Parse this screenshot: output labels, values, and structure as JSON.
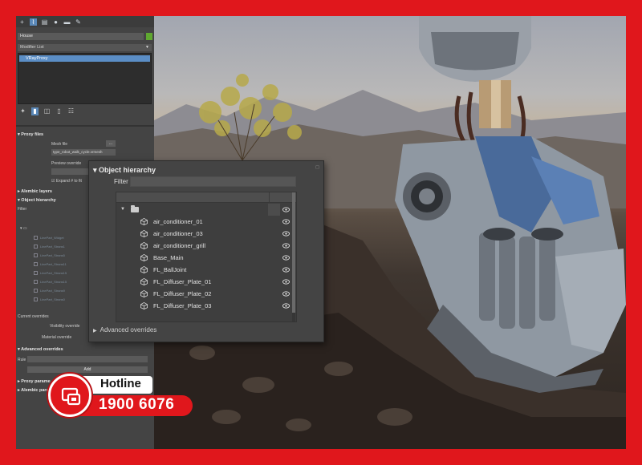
{
  "colors": {
    "border": "#e0171c",
    "panel": "#444444",
    "selection": "#5b8ec6",
    "swatch": "#5fa830"
  },
  "command_panel": {
    "toolbar_icons": [
      "plus-icon",
      "curve-icon",
      "hierarchy-icon",
      "motion-icon",
      "display-icon",
      "utilities-icon"
    ],
    "object_name": "House",
    "modifier_list": "Modifier List",
    "stack": [
      "VRayProxy"
    ],
    "proxy_files": {
      "header": "Proxy files",
      "mesh_file_label": "Mesh file",
      "browse_label": "...",
      "mesh_file_value": "type_robot_walk_cycle.vrmesh",
      "preview_override_label": "Preview override",
      "expand_label": "Expand # to fit"
    },
    "alembic_layers": "Alembic layers",
    "object_hierarchy": "Object hierarchy",
    "filter": "Filter",
    "ghost_items": [
      "LinePart_Widget",
      "LinePart_Strans1",
      "LinePart_Strans5",
      "LinePart_Strans11",
      "LinePart_Strans15",
      "LinePart_Strans15",
      "LinePart_Strans9",
      "LinePart_Strans0"
    ],
    "current_overrides": "Current overrides",
    "visibility_override": "Visibility override",
    "material_override": "Material override",
    "advanced_overrides": "Advanced overrides",
    "rule_label": "Rule",
    "add_button": "Add",
    "proxy_params": "Proxy parame",
    "alembic_params": "Alembic para"
  },
  "dialog": {
    "title": "Object hierarchy",
    "filter_label": "Filter",
    "items": [
      "air_conditioner_01",
      "air_conditioner_03",
      "air_conditioner_grill",
      "Base_Main",
      "FL_BallJoint",
      "FL_Diffuser_Plate_01",
      "FL_Diffuser_Plate_02",
      "FL_Diffuser_Plate_03"
    ],
    "advanced_overrides": "Advanced overrides"
  },
  "hotline": {
    "title": "Hotline",
    "number": "1900 6076"
  }
}
